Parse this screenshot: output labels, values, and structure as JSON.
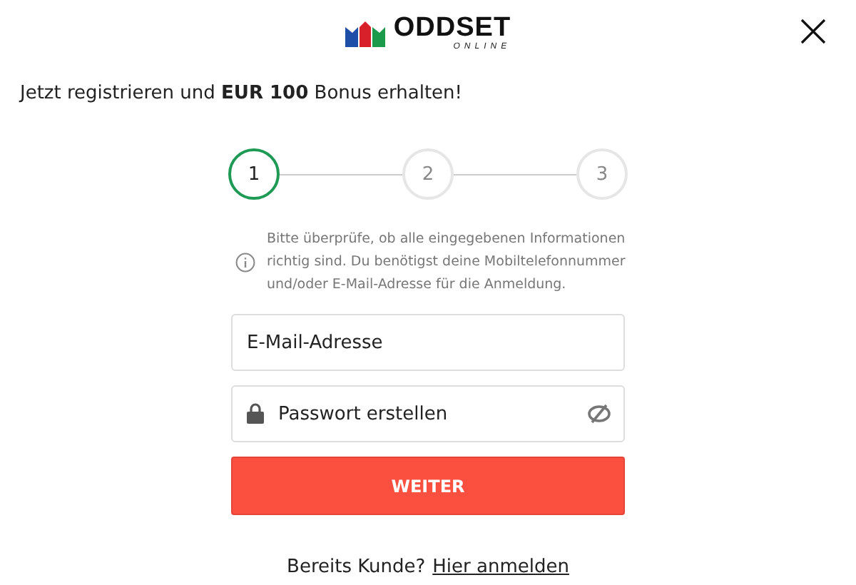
{
  "header": {
    "logo_text": "ODDSET",
    "logo_subtext": "ONLINE"
  },
  "headline": "Jetzt registrieren und **EUR 100** Bonus erhalten!",
  "steps": [
    {
      "label": "1",
      "selected": true
    },
    {
      "label": "2",
      "selected": false
    },
    {
      "label": "3",
      "selected": false
    }
  ],
  "info": "Bitte überprüfe, ob alle eingegebenen Informationen richtig sind. Du benötigst deine Mobiltelefonnummer und/oder E-Mail-Adresse für die Anmeldung.",
  "fields": [
    {
      "kind": "email",
      "placeholder": "E-Mail-Adresse"
    },
    {
      "kind": "password",
      "placeholder": "Passwort erstellen"
    }
  ],
  "submit": "WEITER",
  "footer": {
    "text": "Bereits Kunde?",
    "link": "Hier anmelden"
  }
}
